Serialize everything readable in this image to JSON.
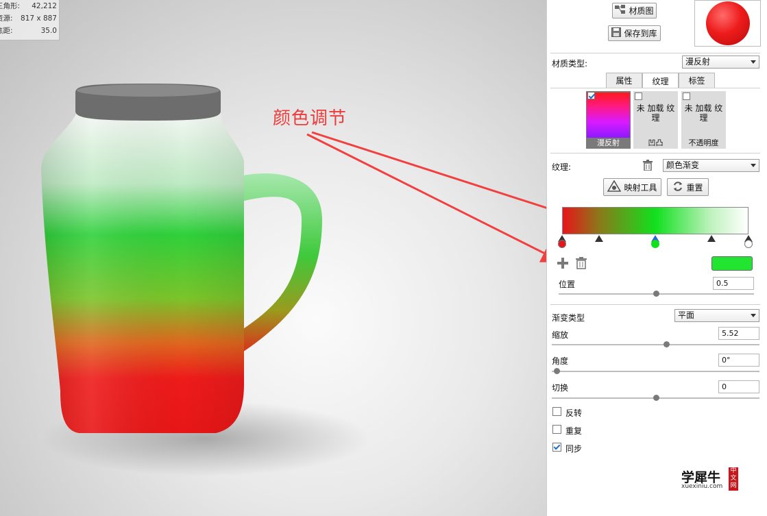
{
  "stats": {
    "rows": [
      {
        "label": "三角形:",
        "value": "42,212"
      },
      {
        "label": "资源:",
        "value": "817 x 887"
      },
      {
        "label": "焦距:",
        "value": "35.0"
      }
    ]
  },
  "annotation": {
    "text": "颜色调节",
    "color": "#ee3b3b"
  },
  "toolbar": {
    "material_graph_label": "材质图",
    "save_to_library_label": "保存到库"
  },
  "material_type": {
    "label": "材质类型:",
    "value": "漫反射"
  },
  "tabs": [
    {
      "label": "属性"
    },
    {
      "label": "纹理"
    },
    {
      "label": "标签"
    }
  ],
  "texture_slots": [
    {
      "checked": true,
      "name": "",
      "caption": "漫反射"
    },
    {
      "checked": false,
      "name": "未 加载 纹理",
      "caption": "凹凸"
    },
    {
      "checked": false,
      "name": "未 加载 纹理",
      "caption": "不透明度"
    }
  ],
  "texture": {
    "label": "纹理:",
    "value": "颜色渐变",
    "mapping_tool_label": "映射工具",
    "reset_label": "重置"
  },
  "gradient": {
    "stops": [
      {
        "position": 0.0,
        "color": "#e8141b"
      },
      {
        "position": 0.2,
        "color": "#8a7a1a"
      },
      {
        "position": 0.5,
        "color": "#11e01d"
      },
      {
        "position": 0.8,
        "color": "#bff2be"
      },
      {
        "position": 1.0,
        "color": "#ffffff"
      }
    ],
    "selected_color": "#22e532"
  },
  "position": {
    "label": "位置",
    "value": "0.5",
    "slider": 0.5
  },
  "gradient_type": {
    "label": "渐变类型",
    "value": "平面"
  },
  "scale": {
    "label": "缩放",
    "value": "5.52",
    "slider": 0.5
  },
  "angle": {
    "label": "角度",
    "value": "0°",
    "slider": 0.0
  },
  "shift": {
    "label": "切换",
    "value": "0",
    "slider": 0.5
  },
  "options": [
    {
      "label": "反转",
      "checked": false
    },
    {
      "label": "重复",
      "checked": false
    },
    {
      "label": "同步",
      "checked": true
    }
  ],
  "watermark": {
    "brand": "学犀牛",
    "site": "xuexiniu.com",
    "badge": "中文网"
  }
}
